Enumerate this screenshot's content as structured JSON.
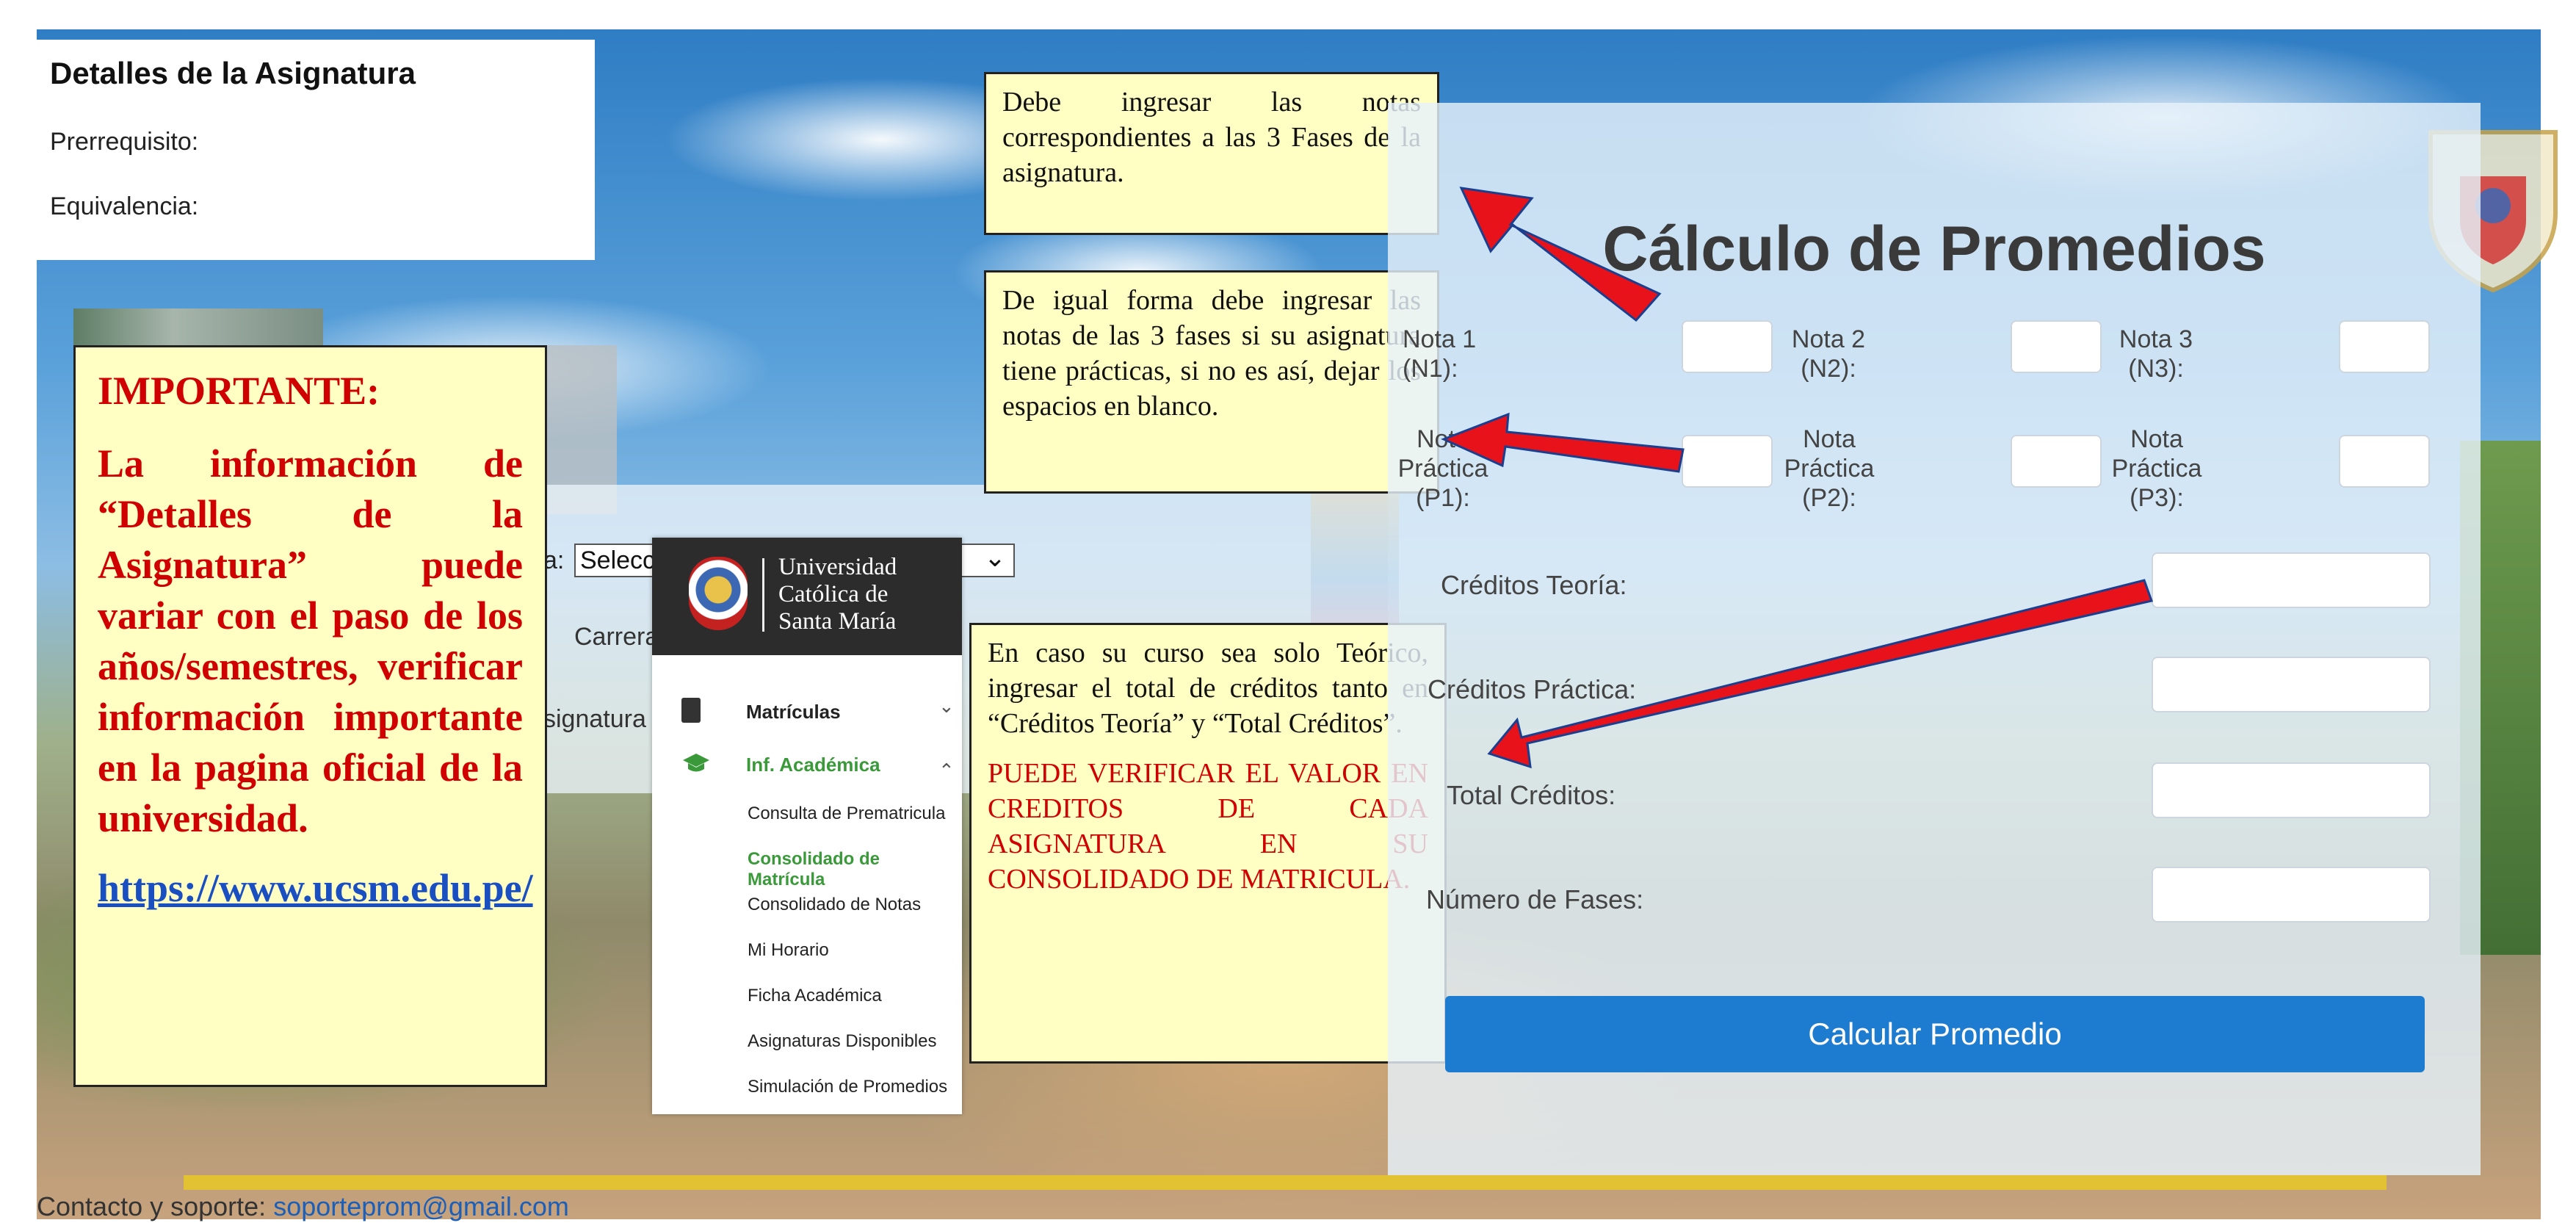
{
  "subject_details": {
    "title": "Detalles de la Asignatura",
    "prerequisite_label": "Prerrequisito:",
    "equivalence_label": "Equivalencia:"
  },
  "important_note": {
    "heading": "IMPORTANTE:",
    "body": "La información de “Detalles de la Asignatura” puede variar con el paso de los años/semestres, verificar información importante en la pagina oficial de la universidad.",
    "link": "https://www.ucsm.edu.pe/"
  },
  "callouts": {
    "phases": "Debe ingresar las notas correspondientes a las 3 Fases de la asignatura.",
    "practice": "De igual forma debe ingresar las notas de las 3 fases si su asignatura tiene prácticas, si no es así, dejar los espacios en blanco.",
    "credits": "En caso su curso sea solo Teórico, ingresar el total de créditos tanto en “Créditos Teoría” y “Total Créditos”.",
    "credits_warning": "PUEDE VERIFICAR EL VALOR EN CREDITOS DE CADA ASIGNATURA EN SU CONSOLIDADO DE MATRICULA."
  },
  "background_form": {
    "select_prefix": "a:",
    "select_value": "Selecc",
    "career_label": "Carrera",
    "subject_label": "signatura"
  },
  "university_menu": {
    "name_lines": [
      "Universidad",
      "Católica de",
      "Santa María"
    ],
    "items": [
      {
        "label": "Matrículas",
        "icon": "book-icon",
        "chevron": "⌄"
      },
      {
        "label": "Inf. Académica",
        "icon": "graduation-cap-icon",
        "chevron": "⌃"
      }
    ],
    "subitems": [
      "Consulta de Prematricula",
      "Consolidado de Matrícula",
      "Consolidado de Notas",
      "Mi Horario",
      "Ficha Académica",
      "Asignaturas Disponibles",
      "Simulación de Promedios"
    ],
    "active_subitem": "Consolidado de Matrícula",
    "accent_color": "#3a9a3a"
  },
  "calculator": {
    "title": "Cálculo de Promedios",
    "grade_labels": [
      "Nota 1\n(N1):",
      "Nota 2\n(N2):",
      "Nota 3\n(N3):"
    ],
    "practice_labels": [
      "Nota\nPráctica\n(P1):",
      "Nota\nPráctica\n(P2):",
      "Nota\nPráctica\n(P3):"
    ],
    "credits_theory_label": "Créditos Teoría:",
    "credits_practice_label": "Créditos Práctica:",
    "total_credits_label": "Total Créditos:",
    "phases_label": "Número de Fases:",
    "button_label": "Calcular Promedio",
    "button_color": "#1e7cd0"
  },
  "footer": {
    "contact_text": "Contacto y soporte:",
    "email": "soporteprom@gmail.com"
  },
  "arrow_color": "#e8121b"
}
